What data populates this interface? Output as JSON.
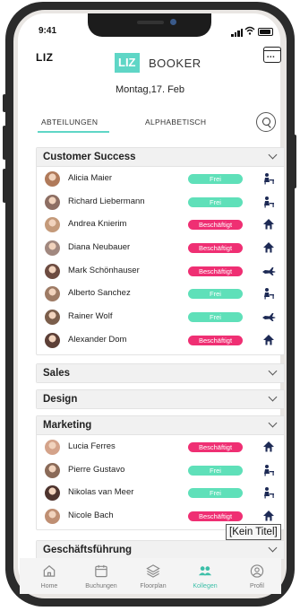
{
  "status": {
    "time": "9:41"
  },
  "header": {
    "brand_short": "LIZ",
    "logo_box": "LIZ",
    "logo_text": "BOOKER",
    "date": "Montag,17. Feb"
  },
  "tabs": [
    {
      "label": "ABTEILUNGEN",
      "active": true
    },
    {
      "label": "ALPHABETISCH",
      "active": false
    }
  ],
  "groups": {
    "customer_success": {
      "title": "Customer Success",
      "people": [
        {
          "name": "Alicia Maier",
          "status": "Frei",
          "loc": "desk-icon"
        },
        {
          "name": "Richard Liebermann",
          "status": "Frei",
          "loc": "desk-icon"
        },
        {
          "name": "Andrea Knierim",
          "status": "Beschäftigt",
          "loc": "home-icon"
        },
        {
          "name": "Diana Neubauer",
          "status": "Beschäftigt",
          "loc": "home-icon"
        },
        {
          "name": "Mark Schönhauser",
          "status": "Beschäftigt",
          "loc": "plane-icon"
        },
        {
          "name": "Alberto Sanchez",
          "status": "Frei",
          "loc": "desk-icon"
        },
        {
          "name": "Rainer Wolf",
          "status": "Frei",
          "loc": "plane-icon"
        },
        {
          "name": "Alexander Dom",
          "status": "Beschäftigt",
          "loc": "home-icon"
        }
      ]
    },
    "sales": {
      "title": "Sales"
    },
    "design": {
      "title": "Design"
    },
    "marketing": {
      "title": "Marketing",
      "people": [
        {
          "name": "Lucia Ferres",
          "status": "Beschäftigt",
          "loc": "home-icon"
        },
        {
          "name": "Pierre Gustavo",
          "status": "Frei",
          "loc": "desk-icon"
        },
        {
          "name": "Nikolas van Meer",
          "status": "Frei",
          "loc": "desk-icon"
        },
        {
          "name": "Nicole Bach",
          "status": "Beschäftigt",
          "loc": "home-icon"
        }
      ]
    },
    "management": {
      "title": "Geschäftsführung"
    }
  },
  "tooltip": "[Kein Titel]",
  "nav": [
    {
      "label": "Home",
      "icon": "home-icon",
      "active": false
    },
    {
      "label": "Buchungen",
      "icon": "calendar-icon",
      "active": false
    },
    {
      "label": "Floorplan",
      "icon": "layers-icon",
      "active": false
    },
    {
      "label": "Kollegen",
      "icon": "people-icon",
      "active": true
    },
    {
      "label": "Profil",
      "icon": "profile-icon",
      "active": false
    }
  ],
  "colors": {
    "accent": "#5fd6c6",
    "free": "#5fe0b9",
    "busy": "#ef2f73"
  }
}
